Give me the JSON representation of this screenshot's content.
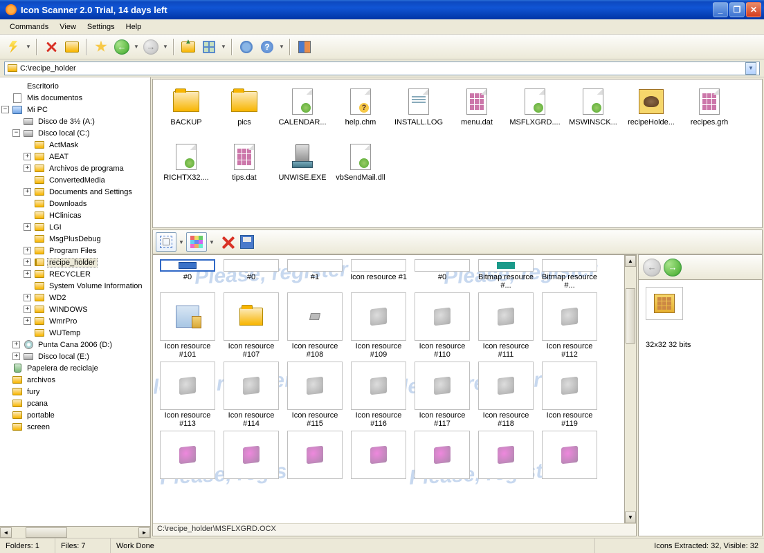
{
  "window": {
    "title": "Icon Scanner 2.0 Trial, 14 days left"
  },
  "menu": {
    "commands": "Commands",
    "view": "View",
    "settings": "Settings",
    "help": "Help"
  },
  "address": {
    "path": "C:\\recipe_holder"
  },
  "tree": {
    "root": "Escritorio",
    "docs": "Mis documentos",
    "mypc": "Mi PC",
    "floppy": "Disco de 3½ (A:)",
    "c": "Disco local (C:)",
    "c_children": [
      "ActMask",
      "AEAT",
      "Archivos de programa",
      "ConvertedMedia",
      "Documents and Settings",
      "Downloads",
      "HClinicas",
      "LGI",
      "MsgPlusDebug",
      "Program Files",
      "recipe_holder",
      "RECYCLER",
      "System Volume Information",
      "WD2",
      "WINDOWS",
      "WmrPro",
      "WUTemp"
    ],
    "d": "Punta Cana 2006 (D:)",
    "e": "Disco local (E:)",
    "trash": "Papelera de reciclaje",
    "extra": [
      "archivos",
      "fury",
      "pcana",
      "portable",
      "screen"
    ]
  },
  "files": [
    {
      "name": "BACKUP",
      "type": "folder"
    },
    {
      "name": "pics",
      "type": "folder"
    },
    {
      "name": "CALENDAR...",
      "type": "doc-gear"
    },
    {
      "name": "help.chm",
      "type": "doc-help"
    },
    {
      "name": "INSTALL.LOG",
      "type": "doc-text"
    },
    {
      "name": "menu.dat",
      "type": "doc-grid"
    },
    {
      "name": "MSFLXGRD....",
      "type": "doc-gear"
    },
    {
      "name": "MSWINSCK...",
      "type": "doc-gear"
    },
    {
      "name": "recipeHolde...",
      "type": "exe-recipe"
    },
    {
      "name": "recipes.grh",
      "type": "doc-grid"
    },
    {
      "name": "RICHTX32....",
      "type": "doc-gear"
    },
    {
      "name": "tips.dat",
      "type": "doc-grid"
    },
    {
      "name": "UNWISE.EXE",
      "type": "exe-unwise"
    },
    {
      "name": "vbSendMail.dll",
      "type": "doc-gear"
    }
  ],
  "resources_row1": [
    {
      "label": "#0",
      "sel": true,
      "tiny": "blue"
    },
    {
      "label": "#0"
    },
    {
      "label": "#1"
    },
    {
      "label": "Icon resource #1"
    },
    {
      "label": "#0"
    },
    {
      "label": "Bitmap resource #...",
      "tiny": "teal"
    },
    {
      "label": "Bitmap resource #..."
    }
  ],
  "resources_row2": [
    {
      "label": "Icon resource #101",
      "ic": "box"
    },
    {
      "label": "Icon resource #107",
      "ic": "folder"
    },
    {
      "label": "Icon resource #108",
      "ic": "small"
    },
    {
      "label": "Icon resource #109",
      "ic": "gen"
    },
    {
      "label": "Icon resource #110",
      "ic": "gen"
    },
    {
      "label": "Icon resource #111",
      "ic": "gen"
    },
    {
      "label": "Icon resource #112",
      "ic": "gen"
    }
  ],
  "resources_row3": [
    {
      "label": "Icon resource #113"
    },
    {
      "label": "Icon resource #114"
    },
    {
      "label": "Icon resource #115"
    },
    {
      "label": "Icon resource #116"
    },
    {
      "label": "Icon resource #117"
    },
    {
      "label": "Icon resource #118"
    },
    {
      "label": "Icon resource #119"
    }
  ],
  "selected_path": "C:\\recipe_holder\\MSFLXGRD.OCX",
  "preview": {
    "label": "32x32 32 bits"
  },
  "status": {
    "folders": "Folders: 1",
    "files": "Files: 7",
    "work": "Work Done",
    "extracted": "Icons Extracted: 32, Visible: 32"
  },
  "watermark": "Please, register"
}
